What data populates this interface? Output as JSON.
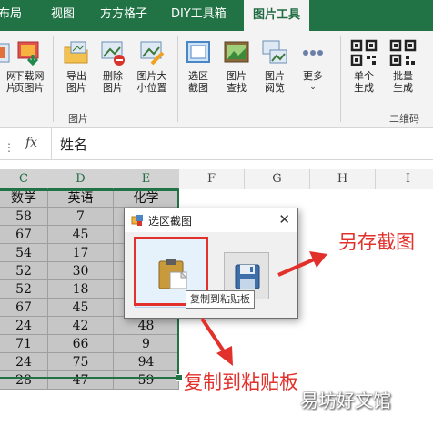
{
  "ribbon_tabs": [
    {
      "label": "布局",
      "active": false
    },
    {
      "label": "视图",
      "active": false
    },
    {
      "label": "方方格子",
      "active": false
    },
    {
      "label": "DIY工具箱",
      "active": false
    },
    {
      "label": "图片工具",
      "active": true
    }
  ],
  "ribbon": {
    "buttons": [
      {
        "label": "网\n片",
        "icon": "picture-icon"
      },
      {
        "label": "下载网\n页图片",
        "icon": "download-picture-icon"
      },
      {
        "label": "导出\n图片",
        "icon": "export-picture-icon"
      },
      {
        "label": "删除\n图片",
        "icon": "delete-picture-icon"
      },
      {
        "label": "图片大\n小位置",
        "icon": "picture-resize-icon"
      },
      {
        "label": "选区\n截图",
        "icon": "screenshot-icon"
      },
      {
        "label": "图片\n查找",
        "icon": "find-picture-icon"
      },
      {
        "label": "图片\n阅览",
        "icon": "browse-picture-icon"
      },
      {
        "label": "更多",
        "icon": "more-icon"
      },
      {
        "label": "单个\n生成",
        "icon": "qr-single-icon"
      },
      {
        "label": "批量\n生成",
        "icon": "qr-batch-icon"
      }
    ],
    "group_labels": {
      "picture": "图片",
      "qrcode": "二维码"
    }
  },
  "formula_bar": {
    "fx": "fx",
    "value": "姓名"
  },
  "columns": [
    "C",
    "D",
    "E",
    "F",
    "G",
    "H",
    "I"
  ],
  "table": {
    "headers": [
      "数学",
      "英语",
      "化学"
    ],
    "rows": [
      [
        "58",
        "7",
        ""
      ],
      [
        "67",
        "45",
        ""
      ],
      [
        "54",
        "17",
        ""
      ],
      [
        "52",
        "30",
        ""
      ],
      [
        "52",
        "18",
        ""
      ],
      [
        "67",
        "45",
        ""
      ],
      [
        "24",
        "42",
        "48"
      ],
      [
        "71",
        "66",
        "9"
      ],
      [
        "24",
        "75",
        "94"
      ],
      [
        "28",
        "47",
        "59"
      ]
    ]
  },
  "dialog": {
    "title": "选区截图",
    "close": "✕",
    "tooltip": "复制到粘贴板"
  },
  "annotations": {
    "save": "另存截图",
    "copy": "复制到粘贴板"
  },
  "watermark": "易坊好文馆",
  "colors": {
    "excel_green": "#217346",
    "annotation_red": "#e2302b"
  }
}
